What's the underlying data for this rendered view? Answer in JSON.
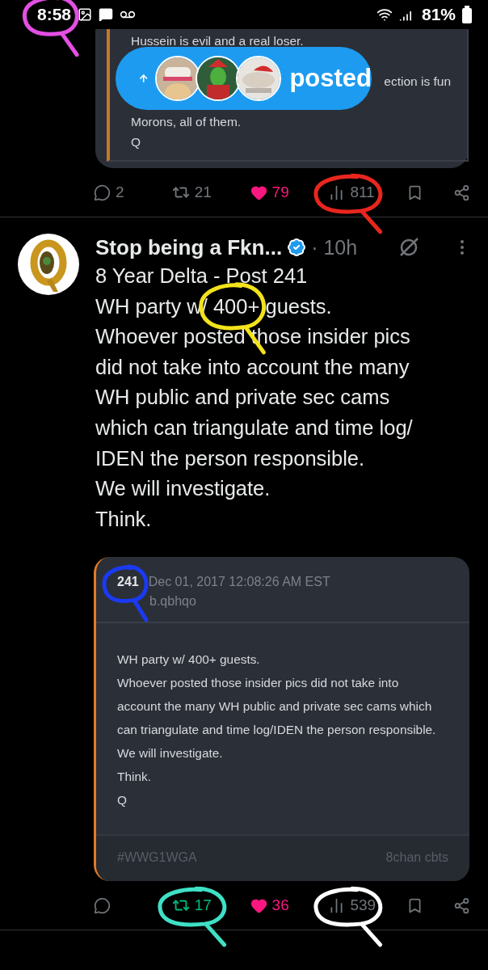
{
  "status_bar": {
    "time": "8:58",
    "time_annotation": {
      "color": "#e34fe3"
    },
    "battery": "81%"
  },
  "quoted_fragment": {
    "lines": [
      {
        "kind": "line",
        "text": "Hussein is evil and a real loser."
      },
      {
        "kind": "covered",
        "text": "ection is fun"
      },
      {
        "kind": "line",
        "text": "Morons, all of them."
      },
      {
        "kind": "line",
        "text": "Q"
      }
    ]
  },
  "posted_pill": {
    "label": "posted"
  },
  "top_stats": [
    {
      "kind": "reply",
      "count": "2"
    },
    {
      "kind": "repost",
      "count": "21",
      "active": false
    },
    {
      "kind": "like",
      "count": "79",
      "active": true
    },
    {
      "kind": "views",
      "count": "811",
      "annotation": {
        "color": "#e8261e"
      }
    },
    {
      "kind": "bookmark"
    },
    {
      "kind": "share"
    }
  ],
  "tweet": {
    "author": "Stop being a Fkn...",
    "verified": true,
    "time": "· 10h",
    "lines": [
      {
        "segments": [
          {
            "text": "8 Year Delta - Post 241"
          }
        ]
      },
      {
        "segments": [
          {
            "text": "WH party w/ "
          },
          {
            "text": "400+",
            "annotation": {
              "color": "#f3e21c"
            }
          },
          {
            "text": " guests."
          }
        ]
      },
      {
        "segments": [
          {
            "text": "Whoever posted those insider pics"
          }
        ]
      },
      {
        "segments": [
          {
            "text": "did not take into account the many"
          }
        ]
      },
      {
        "segments": [
          {
            "text": "WH public and private sec cams"
          }
        ]
      },
      {
        "segments": [
          {
            "text": "which can triangulate and time log/"
          }
        ]
      },
      {
        "segments": [
          {
            "text": "IDEN the person responsible."
          }
        ]
      },
      {
        "segments": [
          {
            "text": "We will investigate."
          }
        ]
      },
      {
        "segments": [
          {
            "text": "Think."
          }
        ]
      }
    ],
    "quote": {
      "post_number": "241",
      "post_number_annotation": {
        "color": "#1a3af2"
      },
      "date": "Dec 01, 2017 12:08:26 AM EST",
      "tripcode": "b.qbhqo",
      "paragraphs": [
        "WH party w/ 400+ guests.",
        "Whoever posted those insider pics did not take into account the many WH public and private sec cams which can triangulate and time log/IDEN the person responsible.",
        "We will investigate.",
        "Think.",
        "Q"
      ],
      "hashtag": "#WWG1WGA",
      "source": "8chan cbts"
    },
    "stats": [
      {
        "kind": "reply"
      },
      {
        "kind": "repost",
        "count": "17",
        "active": true,
        "annotation": {
          "color": "#3fe0c5"
        }
      },
      {
        "kind": "like",
        "count": "36",
        "active": true
      },
      {
        "kind": "views",
        "count": "539",
        "annotation": {
          "color": "#ffffff"
        }
      },
      {
        "kind": "bookmark"
      },
      {
        "kind": "share"
      }
    ]
  }
}
